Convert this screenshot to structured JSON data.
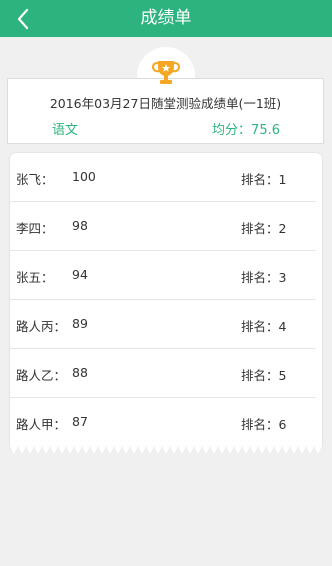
{
  "header": {
    "title": "成绩单",
    "back_icon": "chevron-left-icon"
  },
  "report": {
    "title": "2016年03月27日随堂测验成绩单(一1班)",
    "subject": "语文",
    "average": "均分：75.6",
    "trophy_icon": "trophy-icon"
  },
  "rows": [
    {
      "name": "张飞：",
      "score": "100",
      "rank": "排名：1"
    },
    {
      "name": "李四：",
      "score": "98",
      "rank": "排名：2"
    },
    {
      "name": "张五：",
      "score": "94",
      "rank": "排名：3"
    },
    {
      "name": "路人丙：",
      "score": "89",
      "rank": "排名：4"
    },
    {
      "name": "路人乙：",
      "score": "88",
      "rank": "排名：5"
    },
    {
      "name": "路人甲：",
      "score": "87",
      "rank": "排名：6"
    }
  ],
  "colors": {
    "accent": "#2db37e",
    "trophy": "#f5a623",
    "background": "#f0f0f0"
  }
}
